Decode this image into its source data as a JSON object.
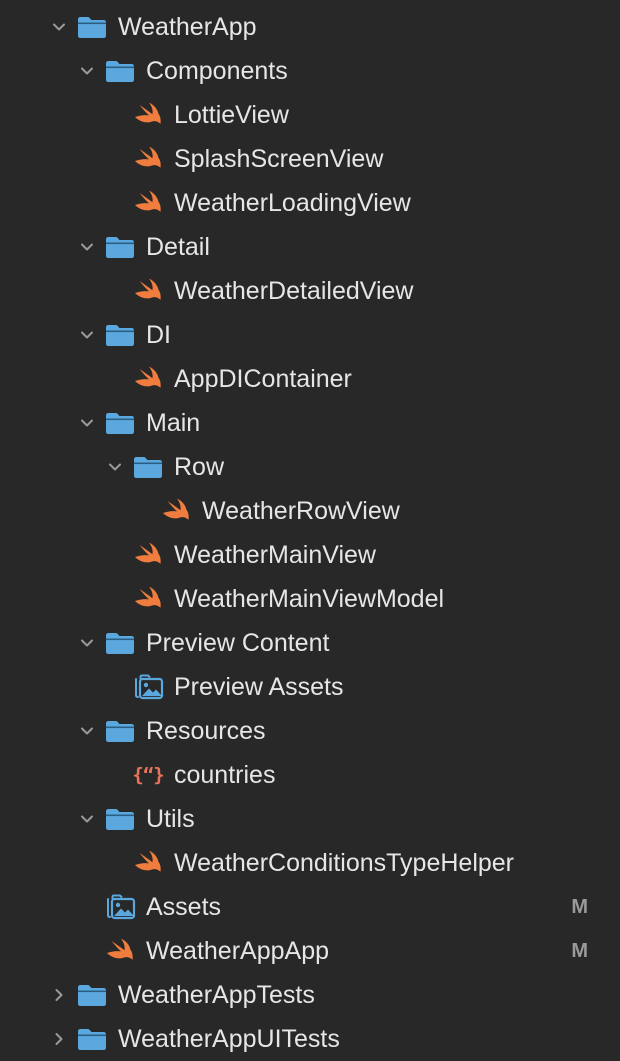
{
  "colors": {
    "background": "#282828",
    "folder": "#5aa8de",
    "swift": "#f07c3e",
    "json": "#e8735a",
    "text": "#e6e6e6",
    "chevron": "#9a9a9a",
    "badge": "#9a9a9a"
  },
  "tree": [
    {
      "id": "weatherapp",
      "label": "WeatherApp",
      "icon": "folder-icon",
      "depth": 0,
      "chevron": "down"
    },
    {
      "id": "components",
      "label": "Components",
      "icon": "folder-icon",
      "depth": 1,
      "chevron": "down"
    },
    {
      "id": "lottieview",
      "label": "LottieView",
      "icon": "swift-file-icon",
      "depth": 2
    },
    {
      "id": "splashscreenview",
      "label": "SplashScreenView",
      "icon": "swift-file-icon",
      "depth": 2
    },
    {
      "id": "weatherloadingview",
      "label": "WeatherLoadingView",
      "icon": "swift-file-icon",
      "depth": 2
    },
    {
      "id": "detail",
      "label": "Detail",
      "icon": "folder-icon",
      "depth": 1,
      "chevron": "down"
    },
    {
      "id": "weatherdetailedview",
      "label": "WeatherDetailedView",
      "icon": "swift-file-icon",
      "depth": 2
    },
    {
      "id": "di",
      "label": "DI",
      "icon": "folder-icon",
      "depth": 1,
      "chevron": "down"
    },
    {
      "id": "appdicontainer",
      "label": "AppDIContainer",
      "icon": "swift-file-icon",
      "depth": 2
    },
    {
      "id": "main",
      "label": "Main",
      "icon": "folder-icon",
      "depth": 1,
      "chevron": "down"
    },
    {
      "id": "row",
      "label": "Row",
      "icon": "folder-icon",
      "depth": 2,
      "chevron": "down"
    },
    {
      "id": "weatherrowview",
      "label": "WeatherRowView",
      "icon": "swift-file-icon",
      "depth": 3
    },
    {
      "id": "weathermainview",
      "label": "WeatherMainView",
      "icon": "swift-file-icon",
      "depth": 2
    },
    {
      "id": "weathermainviewmodel",
      "label": "WeatherMainViewModel",
      "icon": "swift-file-icon",
      "depth": 2
    },
    {
      "id": "preview-content",
      "label": "Preview Content",
      "icon": "folder-icon",
      "depth": 1,
      "chevron": "down"
    },
    {
      "id": "preview-assets",
      "label": "Preview Assets",
      "icon": "asset-catalog-icon",
      "depth": 2
    },
    {
      "id": "resources",
      "label": "Resources",
      "icon": "folder-icon",
      "depth": 1,
      "chevron": "down"
    },
    {
      "id": "countries",
      "label": "countries",
      "icon": "json-file-icon",
      "depth": 2
    },
    {
      "id": "utils",
      "label": "Utils",
      "icon": "folder-icon",
      "depth": 1,
      "chevron": "down"
    },
    {
      "id": "weatherconditionstypehelper",
      "label": "WeatherConditionsTypeHelper",
      "icon": "swift-file-icon",
      "depth": 2
    },
    {
      "id": "assets",
      "label": "Assets",
      "icon": "asset-catalog-icon",
      "depth": 1,
      "badge": "M"
    },
    {
      "id": "weatherappapp",
      "label": "WeatherAppApp",
      "icon": "swift-file-icon",
      "depth": 1,
      "badge": "M"
    },
    {
      "id": "weatherapptests",
      "label": "WeatherAppTests",
      "icon": "folder-icon",
      "depth": 0,
      "chevron": "right"
    },
    {
      "id": "weatherappuitests",
      "label": "WeatherAppUITests",
      "icon": "folder-icon",
      "depth": 0,
      "chevron": "right"
    }
  ]
}
